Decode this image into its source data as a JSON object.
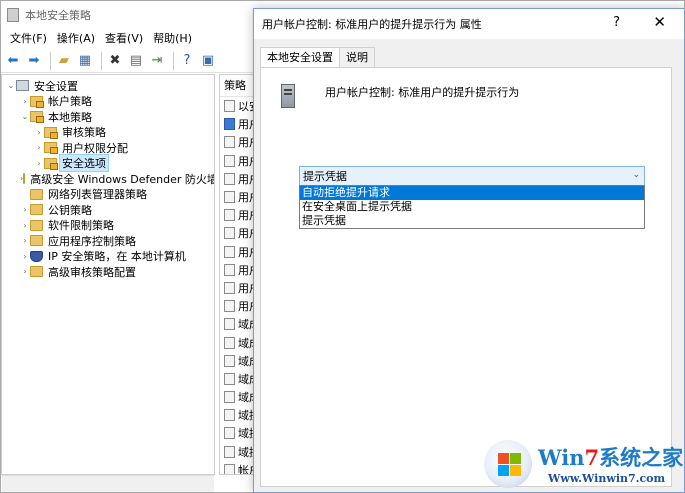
{
  "main_window": {
    "title": "本地安全策略",
    "menu": [
      "文件(F)",
      "操作(A)",
      "查看(V)",
      "帮助(H)"
    ],
    "tree": [
      {
        "label": "安全设置",
        "level": 0,
        "expanded": true,
        "icon": "scope-icon"
      },
      {
        "label": "帐户策略",
        "level": 1,
        "expanded": false,
        "icon": "lock-folder-icon"
      },
      {
        "label": "本地策略",
        "level": 1,
        "expanded": true,
        "icon": "lock-folder-icon"
      },
      {
        "label": "审核策略",
        "level": 2,
        "expanded": false,
        "icon": "lock-folder-icon"
      },
      {
        "label": "用户权限分配",
        "level": 2,
        "expanded": false,
        "icon": "lock-folder-icon"
      },
      {
        "label": "安全选项",
        "level": 2,
        "expanded": false,
        "icon": "lock-folder-icon",
        "selected": true
      },
      {
        "label": "高级安全 Windows Defender 防火墙",
        "level": 1,
        "expanded": false,
        "icon": "folder-icon"
      },
      {
        "label": "网络列表管理器策略",
        "level": 1,
        "expanded": null,
        "icon": "folder-icon"
      },
      {
        "label": "公钥策略",
        "level": 1,
        "expanded": false,
        "icon": "folder-icon"
      },
      {
        "label": "软件限制策略",
        "level": 1,
        "expanded": false,
        "icon": "folder-icon"
      },
      {
        "label": "应用程序控制策略",
        "level": 1,
        "expanded": false,
        "icon": "folder-icon"
      },
      {
        "label": "IP 安全策略，在 本地计算机",
        "level": 1,
        "expanded": false,
        "icon": "shield-icon"
      },
      {
        "label": "高级审核策略配置",
        "level": 1,
        "expanded": false,
        "icon": "folder-icon"
      }
    ],
    "policy_column_header": "策略",
    "policy_rows": [
      "以安",
      "用户",
      "用户",
      "用户",
      "用户",
      "用户",
      "用户",
      "用户",
      "用户",
      "用户",
      "用户",
      "用户",
      "域成",
      "域成",
      "域成",
      "域成",
      "域成",
      "域控",
      "域控",
      "域控",
      "帐户"
    ],
    "active_policy_rows": [
      1
    ]
  },
  "dialog": {
    "title": "用户帐户控制: 标准用户的提升提示行为 属性",
    "help_glyph": "?",
    "close_glyph": "✕",
    "tabs": [
      "本地安全设置",
      "说明"
    ],
    "active_tab": 0,
    "policy_title": "用户帐户控制: 标准用户的提升提示行为",
    "combo_value": "提示凭据",
    "options": [
      "自动拒绝提升请求",
      "在安全桌面上提示凭据",
      "提示凭据"
    ],
    "highlighted_option": 0
  },
  "watermark": {
    "brand_prefix": "Win",
    "brand_seven": "7",
    "brand_suffix": "系统之家",
    "url": "Www.Winwin7.com"
  }
}
